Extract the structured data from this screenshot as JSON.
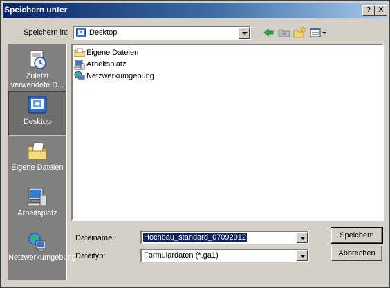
{
  "window": {
    "title": "Speichern unter",
    "help_label": "?",
    "close_label": "X"
  },
  "location": {
    "label": "Speichern in:",
    "value": "Desktop"
  },
  "toolbar": {
    "icons": [
      "back-arrow-icon",
      "up-folder-icon",
      "new-folder-icon",
      "view-menu-icon"
    ]
  },
  "places": [
    {
      "label": "Zuletzt verwendete D...",
      "icon": "recent-documents-icon"
    },
    {
      "label": "Desktop",
      "icon": "desktop-icon",
      "selected": true
    },
    {
      "label": "Eigene Dateien",
      "icon": "my-documents-icon"
    },
    {
      "label": "Arbeitsplatz",
      "icon": "my-computer-icon"
    },
    {
      "label": "Netzwerkumgebung",
      "icon": "network-places-icon"
    }
  ],
  "files": [
    {
      "name": "Eigene Dateien",
      "icon": "folder-icon"
    },
    {
      "name": "Arbeitsplatz",
      "icon": "my-computer-icon"
    },
    {
      "name": "Netzwerkumgebung",
      "icon": "network-places-icon"
    }
  ],
  "filename": {
    "label": "Dateiname:",
    "value": "Hochbau_standard_07092012"
  },
  "filetype": {
    "label": "Dateityp:",
    "value": "Formulardaten (*.ga1)"
  },
  "buttons": {
    "save": "Speichern",
    "cancel": "Abbrechen"
  }
}
